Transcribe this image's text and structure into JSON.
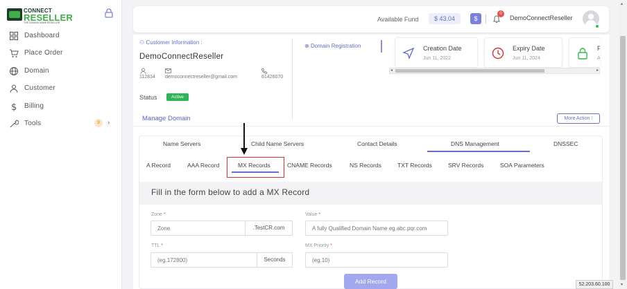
{
  "brand": {
    "line1": "CONNECT",
    "line2": "RESELLER",
    "tagline": "THE DOMAIN NAME RESELLER"
  },
  "sidebar": {
    "items": [
      {
        "label": "Dashboard",
        "icon": "dashboard-icon"
      },
      {
        "label": "Place Order",
        "icon": "cart-icon"
      },
      {
        "label": "Domain",
        "icon": "globe-icon"
      },
      {
        "label": "Customer",
        "icon": "user-icon"
      },
      {
        "label": "Billing",
        "icon": "dollar-icon"
      },
      {
        "label": "Tools",
        "icon": "wrench-icon",
        "badge": "9"
      }
    ]
  },
  "header": {
    "fund_label": "Available Fund",
    "fund_value": "$ 43.04",
    "dollar_button": "$",
    "notification_count": "0",
    "username": "DemoConnectReseller"
  },
  "customer": {
    "section_title": "Customer Information :",
    "name": "DemoConnectReseller",
    "id": "112834",
    "email": "democonnectreseller@gmail.com",
    "phone": "61426070",
    "status_label": "Status",
    "status_value": "Active"
  },
  "domain_registration": {
    "label": "Domain Registration"
  },
  "stat_cards": [
    {
      "title": "Creation Date",
      "date": "Jun 11, 2022"
    },
    {
      "title": "Expiry Date",
      "date": "Jun 11, 2024"
    },
    {
      "title": "Pr",
      "date": "Ac"
    }
  ],
  "manage": {
    "title": "Manage Domain",
    "more_action": "More Action ⁝"
  },
  "tabs_primary": [
    "Name Servers",
    "Child Name Servers",
    "Contact Details",
    "DNS Management",
    "DNSSEC"
  ],
  "tabs_primary_active": "DNS Management",
  "tabs_secondary": [
    "A Record",
    "AAA Record",
    "MX Records",
    "CNAME Records",
    "NS Records",
    "TXT Records",
    "SRV Records",
    "SOA Parameters"
  ],
  "tabs_secondary_active": "MX Records",
  "form": {
    "heading": "Fill in the form below to add a MX Record",
    "zone_label": "Zone",
    "zone_placeholder": "Zone",
    "zone_suffix": ".TestCR.com",
    "value_label": "Value",
    "value_placeholder": "A fully Qualified Domain Name eg.abc.pqr.com",
    "ttl_label": "TTL",
    "ttl_placeholder": "(eg.172800)",
    "ttl_suffix": "Seconds",
    "priority_label": "MX Priority",
    "priority_placeholder": "(eg.10)",
    "submit": "Add Record"
  },
  "footer": {
    "ip": "52.203.60.100"
  },
  "colors": {
    "accent": "#6770c6",
    "green": "#31b357",
    "highlight": "#d9302c"
  }
}
